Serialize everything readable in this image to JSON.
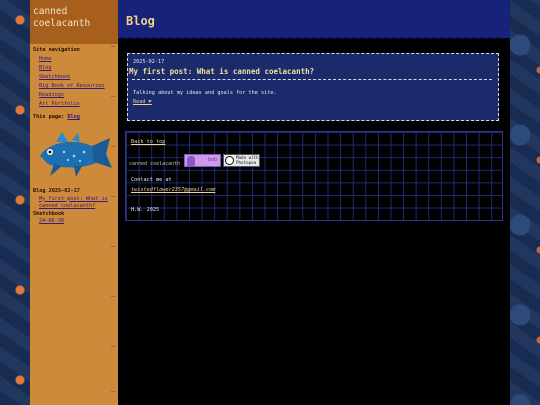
{
  "site": {
    "title": "canned coelacanth"
  },
  "sidebar": {
    "nav_heading": "Site navigation",
    "nav_items": [
      {
        "label": "Home"
      },
      {
        "label": "Blog"
      },
      {
        "label": "Sketchbook"
      },
      {
        "label": "Big Book of Resources"
      },
      {
        "label": "Readings"
      },
      {
        "label": "Art Portfolio"
      }
    ],
    "this_page_prefix": "This page:",
    "this_page_link": "Blog",
    "blog_heading": "Blog 2025-02-17",
    "blog_link": "My first post: What is canned coelacanth?",
    "sketchbook_heading": "Sketchbook",
    "sketchbook_link": "24-06-30"
  },
  "header": {
    "title": "Blog"
  },
  "post": {
    "date": "2025-02-17",
    "title": "My first post: What is canned coelacanth?",
    "summary": "Talking about my ideas and goals for the site.",
    "read_more": "Read"
  },
  "footer": {
    "back_to_top": "Back to top",
    "logo_alt": "canned coelacanth",
    "badge_bob": "bob",
    "badge_photo": "Made with Photopea",
    "contact_label": "Contact me at",
    "email": "twistedflower2357@gmail.com",
    "year": "H.W. 2025"
  },
  "colors": {
    "sidebar": "#cc8a3a",
    "header": "#17227a",
    "accent": "#f0d28a"
  }
}
